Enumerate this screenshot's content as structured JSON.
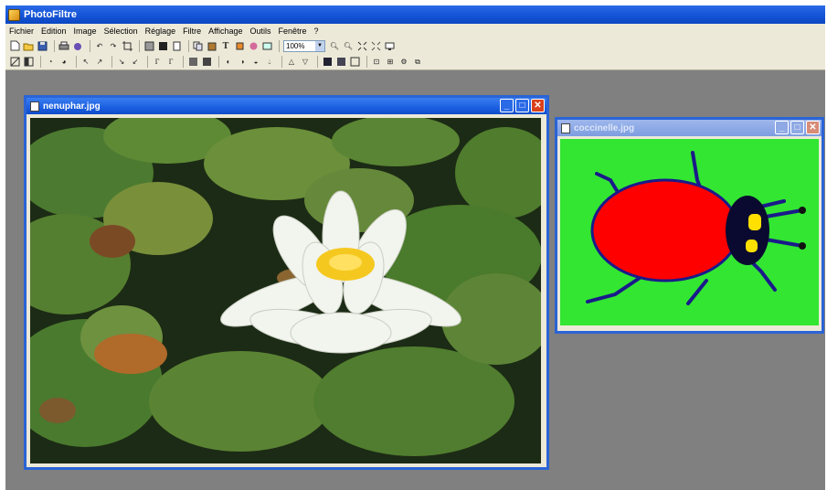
{
  "app": {
    "title": "PhotoFiltre"
  },
  "menu": [
    "Fichier",
    "Edition",
    "Image",
    "Sélection",
    "Réglage",
    "Filtre",
    "Affichage",
    "Outils",
    "Fenêtre",
    "?"
  ],
  "toolbar": {
    "zoom_value": "100%"
  },
  "windows": [
    {
      "title": "nenuphar.jpg",
      "active": true
    },
    {
      "title": "coccinelle.jpg",
      "active": false
    }
  ],
  "icons": {
    "app": "photofiltre-app-icon",
    "document": "document-icon",
    "minimize": "minimize-icon",
    "maximize": "maximize-icon",
    "close": "close-icon"
  },
  "colors": {
    "desktop": "#808080",
    "titlebar_active": "#1556d8",
    "close_button": "#d9401b",
    "ladybug_background": "#32e632",
    "ladybug_body": "#ff0000",
    "ladybug_head": "#0a0a30",
    "ladybug_spots": "#ffe000"
  }
}
